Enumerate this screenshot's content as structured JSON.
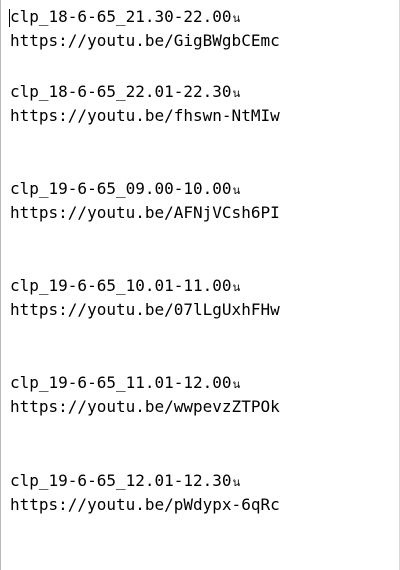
{
  "document": {
    "entries": [
      {
        "title": "clp_18-6-65_21.30-22.00",
        "suffix": "น",
        "link": "https://youtu.be/GigBWgbCEmc"
      },
      {
        "title": "clp_18-6-65_22.01-22.30",
        "suffix": "น",
        "link": "https://youtu.be/fhswn-NtMIw"
      },
      {
        "title": "clp_19-6-65_09.00-10.00",
        "suffix": "น",
        "link": "https://youtu.be/AFNjVCsh6PI"
      },
      {
        "title": "clp_19-6-65_10.01-11.00",
        "suffix": "น",
        "link": "https://youtu.be/07lLgUxhFHw"
      },
      {
        "title": "clp_19-6-65_11.01-12.00",
        "suffix": "น",
        "link": "https://youtu.be/wwpevzZTPOk"
      },
      {
        "title": "clp_19-6-65_12.01-12.30",
        "suffix": "น",
        "link": "https://youtu.be/pWdypx-6qRc"
      }
    ]
  }
}
